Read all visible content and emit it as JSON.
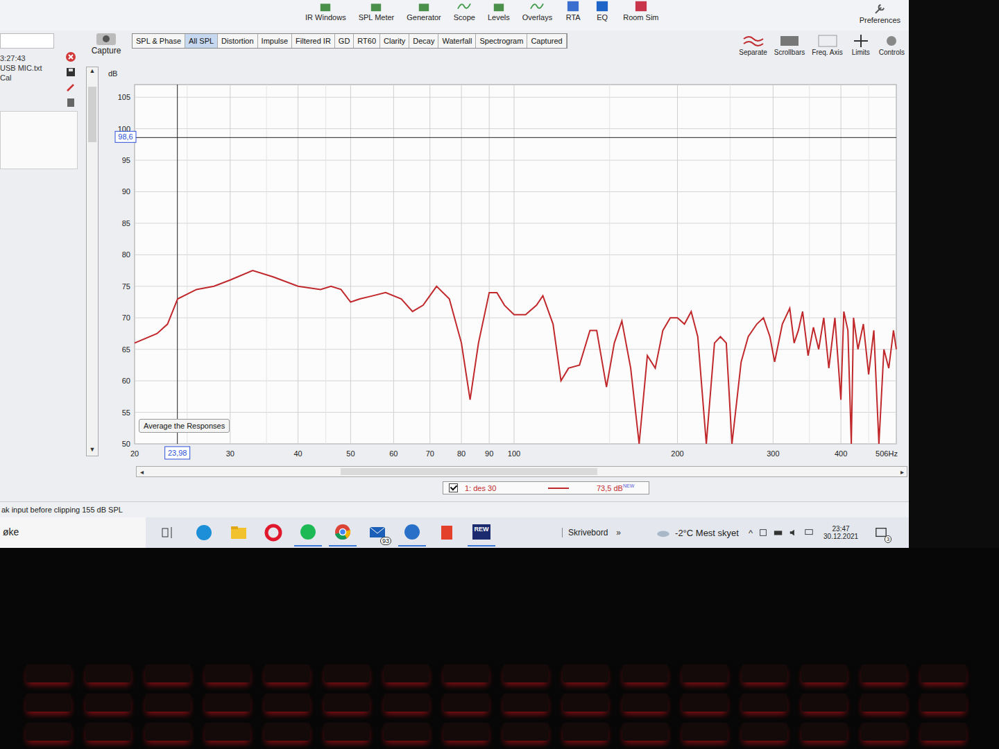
{
  "toolbar": {
    "items": [
      {
        "label": "IR Windows",
        "kind": "ir"
      },
      {
        "label": "SPL Meter",
        "kind": "spl"
      },
      {
        "label": "Generator",
        "kind": "generator"
      },
      {
        "label": "Scope",
        "kind": "scope"
      },
      {
        "label": "Levels",
        "kind": "levels"
      },
      {
        "label": "Overlays",
        "kind": "overlays"
      },
      {
        "label": "RTA",
        "kind": "rta"
      },
      {
        "label": "EQ",
        "kind": "eq"
      },
      {
        "label": "Room Sim",
        "kind": "roomsim"
      }
    ],
    "preferences": "Preferences"
  },
  "side_panel": {
    "lines": [
      "3:27:43",
      "USB MIC.txt",
      "Cal"
    ]
  },
  "capture": "Capture",
  "tabs": [
    {
      "label": "SPL & Phase",
      "selected": false
    },
    {
      "label": "All SPL",
      "selected": true
    },
    {
      "label": "Distortion",
      "selected": false
    },
    {
      "label": "Impulse",
      "selected": false
    },
    {
      "label": "Filtered IR",
      "selected": false
    },
    {
      "label": "GD",
      "selected": false
    },
    {
      "label": "RT60",
      "selected": false
    },
    {
      "label": "Clarity",
      "selected": false
    },
    {
      "label": "Decay",
      "selected": false
    },
    {
      "label": "Waterfall",
      "selected": false
    },
    {
      "label": "Spectrogram",
      "selected": false
    },
    {
      "label": "Captured",
      "selected": false
    }
  ],
  "view_tools": [
    {
      "label": "Separate",
      "kind": "separate"
    },
    {
      "label": "Scrollbars",
      "kind": "scrollbars"
    },
    {
      "label": "Freq. Axis",
      "kind": "freq"
    },
    {
      "label": "Limits",
      "kind": "limits"
    },
    {
      "label": "Controls",
      "kind": "controls"
    }
  ],
  "chart": {
    "y_label": "dB",
    "y_ticks": [
      "105",
      "100",
      "95",
      "90",
      "85",
      "80",
      "75",
      "70",
      "65",
      "60",
      "55",
      "50"
    ],
    "x_ticks": [
      "20",
      "30",
      "40",
      "50",
      "60",
      "70",
      "80",
      "90",
      "100",
      "200",
      "300",
      "400",
      "506Hz"
    ],
    "cursor": {
      "x": "23,98",
      "y": "98,6"
    },
    "average_button": "Average the Responses",
    "series": [
      {
        "name": "1: des 30",
        "checked": true,
        "reading": "73,5 dB",
        "badge": "NEW",
        "color": "#c0282b",
        "frequencies": [
          20,
          22,
          23,
          24,
          26,
          28,
          30,
          33,
          36,
          40,
          44,
          46,
          48,
          50,
          52,
          55,
          58,
          62,
          65,
          68,
          72,
          76,
          80,
          83,
          86,
          90,
          93,
          96,
          100,
          105,
          110,
          113,
          118,
          122,
          126,
          132,
          138,
          142,
          148,
          153,
          158,
          164,
          170,
          176,
          182,
          188,
          194,
          200,
          206,
          212,
          218,
          226,
          234,
          240,
          246,
          252,
          262,
          270,
          280,
          288,
          296,
          302,
          312,
          322,
          328,
          334,
          340,
          348,
          356,
          364,
          372,
          380,
          390,
          400,
          405,
          412,
          418,
          422,
          430,
          440,
          450,
          460,
          470,
          480,
          490,
          500,
          506
        ],
        "values": [
          66,
          67.5,
          69,
          73,
          74.5,
          75,
          76,
          77.5,
          76.5,
          75,
          74.5,
          75,
          74.5,
          72.5,
          73,
          73.5,
          74,
          73,
          71,
          72,
          75,
          73,
          66,
          57,
          66,
          74,
          74,
          72,
          70.5,
          70.5,
          72,
          73.5,
          69,
          60,
          62,
          62.5,
          68,
          68,
          59,
          66,
          69.5,
          62,
          50,
          64,
          62,
          68,
          70,
          70,
          69,
          71,
          67,
          50,
          66,
          67,
          66,
          50,
          63,
          67,
          69,
          70,
          67,
          63,
          69,
          71.5,
          66,
          68,
          71,
          64,
          68.5,
          65,
          70,
          62,
          70,
          57,
          71,
          68,
          50,
          70,
          65,
          69,
          61,
          68,
          50,
          65,
          62,
          68,
          65
        ]
      }
    ]
  },
  "status_bar": "ak input before clipping 155 dB SPL",
  "taskbar": {
    "search": "øke",
    "apps": [
      {
        "kind": "taskview",
        "running": false,
        "badge": "",
        "label": ""
      },
      {
        "kind": "edge",
        "running": false,
        "badge": "",
        "label": ""
      },
      {
        "kind": "explorer",
        "running": false,
        "badge": "",
        "label": ""
      },
      {
        "kind": "opera",
        "running": false,
        "badge": "",
        "label": ""
      },
      {
        "kind": "spotify",
        "running": true,
        "badge": "",
        "label": ""
      },
      {
        "kind": "chrome",
        "running": true,
        "badge": "",
        "label": ""
      },
      {
        "kind": "mail",
        "running": false,
        "badge": "93",
        "label": ""
      },
      {
        "kind": "media",
        "running": true,
        "badge": "",
        "label": ""
      },
      {
        "kind": "office",
        "running": false,
        "badge": "",
        "label": ""
      },
      {
        "kind": "rew",
        "running": true,
        "badge": "",
        "label": "REW"
      }
    ],
    "desktop": "Skrivebord",
    "chevron": "»",
    "weather": "-2°C Mest skyet",
    "tray_arrow": "^",
    "time": "23:47",
    "date": "30.12.2021",
    "notifications": "3"
  }
}
